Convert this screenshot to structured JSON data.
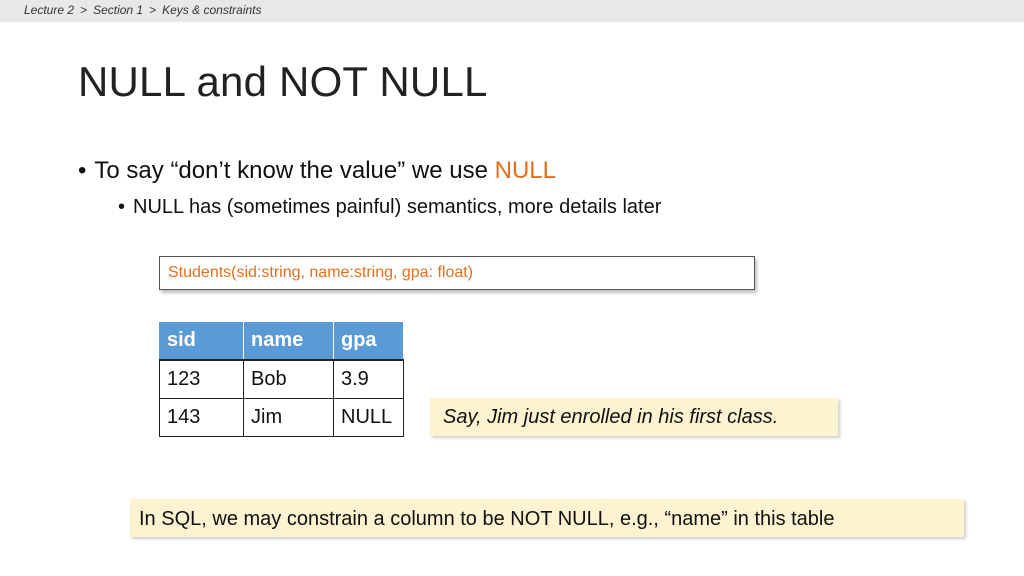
{
  "breadcrumb": {
    "items": [
      "Lecture 2",
      "Section 1",
      "Keys & constraints"
    ],
    "separator": ">"
  },
  "slide": {
    "title": "NULL and NOT NULL",
    "bullet1_prefix": "To say “don’t know the value” we use ",
    "bullet1_highlight": "NULL",
    "bullet2": "NULL has (sometimes painful) semantics, more details later",
    "schema": "Students(sid:string, name:string, gpa: float)",
    "table": {
      "headers": [
        "sid",
        "name",
        "gpa"
      ],
      "rows": [
        [
          "123",
          "Bob",
          "3.9"
        ],
        [
          "143",
          "Jim",
          "NULL"
        ]
      ]
    },
    "callout": "Say, Jim just enrolled in his first class.",
    "sql_note": "In SQL, we may constrain a column to be NOT NULL, e.g., “name” in this table"
  },
  "colors": {
    "accent": "#e07020",
    "table_header": "#5b9bd5",
    "note_background": "#fdf3d0",
    "topbar": "#e8e8e8"
  }
}
